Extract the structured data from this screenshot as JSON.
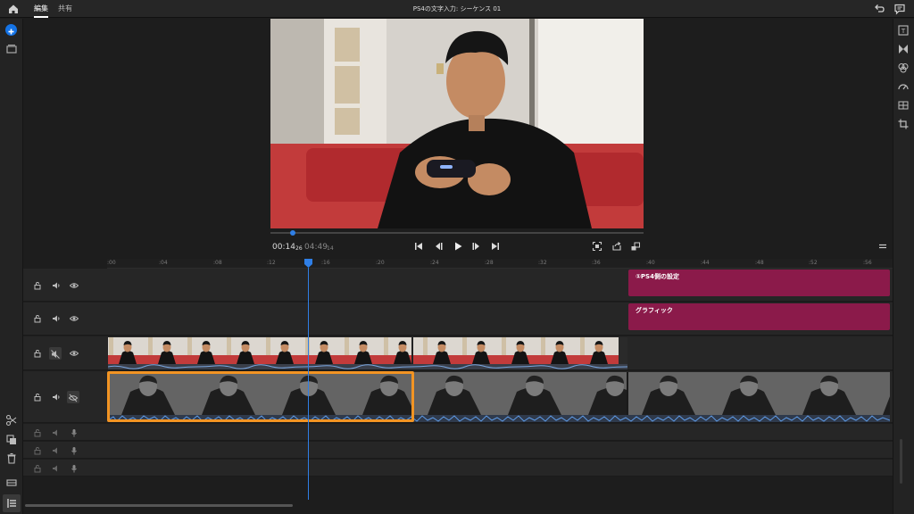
{
  "topbar": {
    "tabs": [
      {
        "label": "編集",
        "active": true
      },
      {
        "label": "共有",
        "active": false
      }
    ],
    "title": "PS4の文字入力: シーケンス 01"
  },
  "player": {
    "current_time": "00:14",
    "current_frames": "26",
    "total_time": "04:49",
    "total_frames": "14",
    "scrub_position_fraction": 0.054
  },
  "timeline": {
    "ruler_labels": [
      ":00",
      ":04",
      ":08",
      ":12",
      ":16",
      ":20",
      ":24",
      ":28",
      ":32",
      ":36",
      ":40",
      ":44",
      ":48",
      ":52",
      ":56"
    ],
    "title_clips": [
      {
        "label": "①PS4側の設定"
      },
      {
        "label": "グラフィック"
      }
    ]
  },
  "colors": {
    "accent_blue": "#2f7fe6",
    "title_clip": "#8b1a4a",
    "selection": "#f29423",
    "background": "#1d1d1d"
  }
}
